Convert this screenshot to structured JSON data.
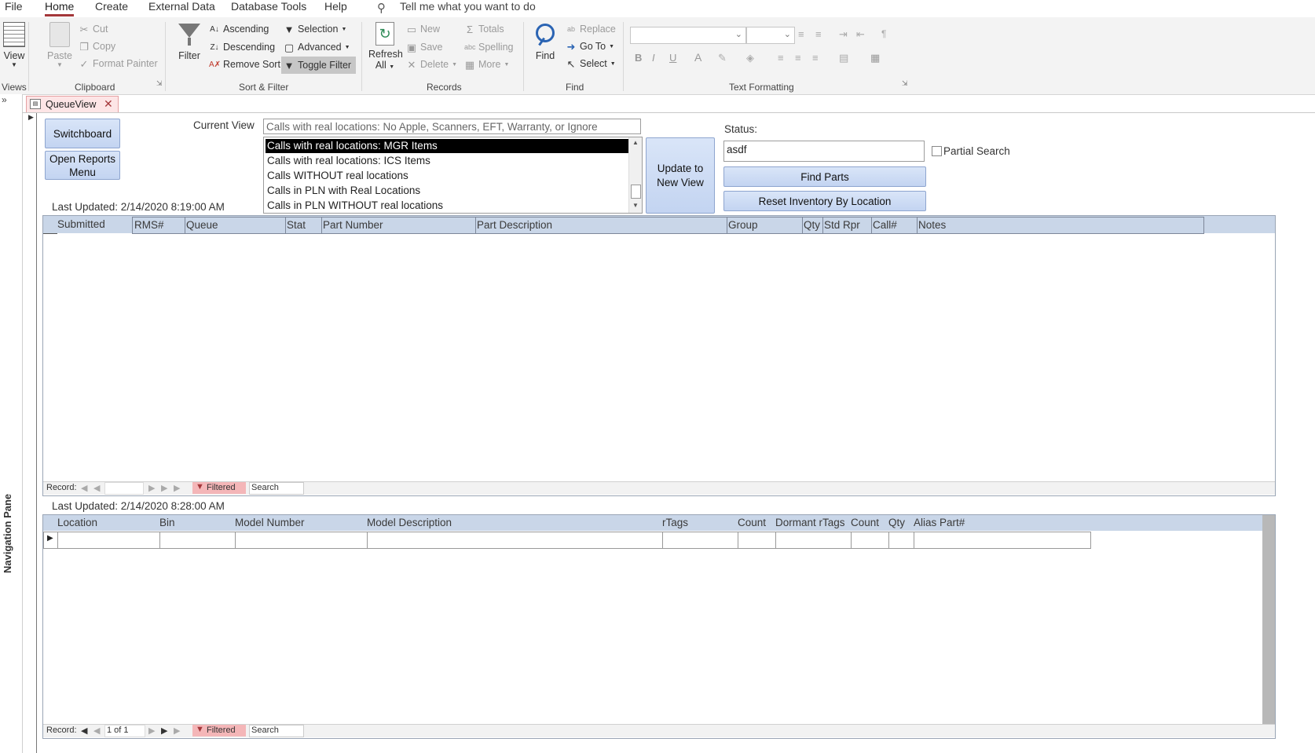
{
  "menu": {
    "items": [
      "File",
      "Home",
      "Create",
      "External Data",
      "Database Tools",
      "Help"
    ],
    "tell_me": "Tell me what you want to do"
  },
  "ribbon": {
    "views": {
      "view_label": "View",
      "group": "Views"
    },
    "clipboard": {
      "paste": "Paste",
      "cut": "Cut",
      "copy": "Copy",
      "format_painter": "Format Painter",
      "group": "Clipboard"
    },
    "sort_filter": {
      "filter": "Filter",
      "ascending": "Ascending",
      "descending": "Descending",
      "remove_sort": "Remove Sort",
      "selection": "Selection",
      "advanced": "Advanced",
      "toggle_filter": "Toggle Filter",
      "group": "Sort & Filter"
    },
    "records": {
      "refresh_line1": "Refresh",
      "refresh_line2": "All",
      "new": "New",
      "save": "Save",
      "delete": "Delete",
      "totals": "Totals",
      "spelling": "Spelling",
      "more": "More",
      "group": "Records"
    },
    "find": {
      "find": "Find",
      "replace": "Replace",
      "go_to": "Go To",
      "select": "Select",
      "group": "Find"
    },
    "text_formatting": {
      "bold": "B",
      "italic": "I",
      "underline": "U",
      "font_color": "A",
      "group": "Text Formatting"
    }
  },
  "nav_pane": {
    "label": "Navigation Pane"
  },
  "doc_tab": {
    "title": "QueueView"
  },
  "form": {
    "switchboard": "Switchboard",
    "open_reports_line1": "Open Reports",
    "open_reports_line2": "Menu",
    "current_view_label": "Current View",
    "current_view_value": "Calls with real locations: No Apple, Scanners, EFT, Warranty, or Ignore",
    "view_list": [
      "Calls with real locations: MGR Items",
      "Calls with real locations: ICS Items",
      "Calls WITHOUT real locations",
      "Calls in PLN with Real Locations",
      "Calls in PLN WITHOUT real locations"
    ],
    "view_list_selected_index": 0,
    "update_view_line1": "Update to",
    "update_view_line2": "New View",
    "status_label": "Status:",
    "status_value": "asdf",
    "partial_search": "Partial Search",
    "find_parts": "Find Parts",
    "reset_inventory": "Reset Inventory By Location",
    "last_updated_1": "Last Updated: 2/14/2020 8:19:00 AM",
    "last_updated_2": "Last Updated: 2/14/2020 8:28:00 AM"
  },
  "grid1": {
    "columns": [
      "Submitted",
      "RMS#",
      "Queue",
      "Stat",
      "Part Number",
      "Part Description",
      "Group",
      "Qty",
      "Std Rpr",
      "Call#",
      "Notes"
    ],
    "nav": {
      "record_label": "Record:",
      "record_value": "",
      "filtered": "Filtered",
      "search": "Search"
    }
  },
  "grid2": {
    "columns": [
      "Location",
      "Bin",
      "Model Number",
      "Model Description",
      "rTags",
      "Count",
      "Dormant rTags",
      "Count",
      "Qty",
      "Alias Part#"
    ],
    "nav": {
      "record_label": "Record:",
      "record_value": "1 of 1",
      "filtered": "Filtered",
      "search": "Search"
    }
  },
  "colors": {
    "accent": "#a4373a",
    "button_blue": "#c9d8f3",
    "header_blue": "#c9d6e8",
    "filtered_pink": "#f4b6b8"
  }
}
